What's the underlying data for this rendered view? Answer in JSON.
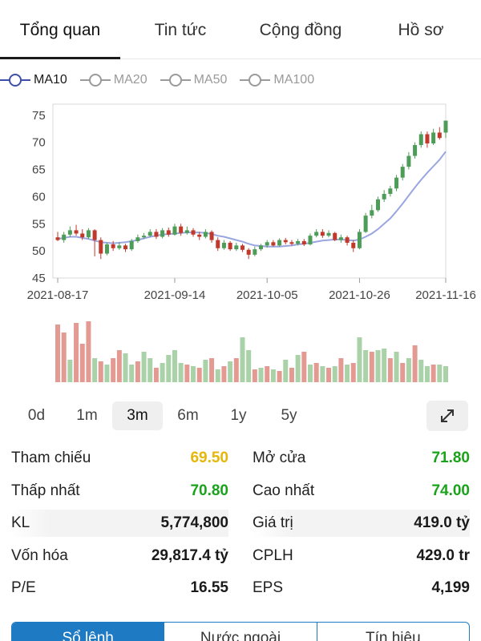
{
  "tabs": [
    "Tổng quan",
    "Tin tức",
    "Cộng đồng",
    "Hồ sơ"
  ],
  "legend": [
    {
      "label": "MA10",
      "active": true
    },
    {
      "label": "MA20",
      "active": false
    },
    {
      "label": "MA50",
      "active": false
    },
    {
      "label": "MA100",
      "active": false
    }
  ],
  "ranges": [
    "0d",
    "1m",
    "3m",
    "6m",
    "1y",
    "5y"
  ],
  "active_range": "3m",
  "expand_icon": "expand-icon",
  "stats": {
    "reference": {
      "label": "Tham chiếu",
      "value": "69.50"
    },
    "open": {
      "label": "Mở cửa",
      "value": "71.80"
    },
    "low": {
      "label": "Thấp nhất",
      "value": "70.80"
    },
    "high": {
      "label": "Cao nhất",
      "value": "74.00"
    },
    "volume": {
      "label": "KL",
      "value": "5,774,800"
    },
    "trade_value": {
      "label": "Giá trị",
      "value": "419.0 tỷ"
    },
    "market_cap": {
      "label": "Vốn hóa",
      "value": "29,817.4 tỷ"
    },
    "shares": {
      "label": "CPLH",
      "value": "429.0 tr"
    },
    "pe": {
      "label": "P/E",
      "value": "16.55"
    },
    "eps": {
      "label": "EPS",
      "value": "4,199"
    }
  },
  "bottom_tabs": [
    "Sổ lệnh",
    "Nước ngoài",
    "Tín hiệu"
  ],
  "colors": {
    "up": "#4d9c57",
    "down": "#c0392b",
    "ma": "#9aa6e0",
    "vol_up": "#a9d2a8",
    "vol_down": "#e39a92"
  },
  "chart_data": {
    "type": "candlestick",
    "y_ticks": [
      75,
      70,
      65,
      60,
      55,
      50,
      45
    ],
    "ylim": [
      45,
      76
    ],
    "x_labels": [
      "2021-08-17",
      "2021-09-14",
      "2021-10-05",
      "2021-10-26",
      "2021-11-16"
    ],
    "x_label_index": [
      0,
      19,
      34,
      49,
      63
    ],
    "candles": [
      [
        52.5,
        52.0,
        53.5,
        51.8
      ],
      [
        52.0,
        53.0,
        53.5,
        51.5
      ],
      [
        53.0,
        53.8,
        54.5,
        52.5
      ],
      [
        53.8,
        53.2,
        54.8,
        52.8
      ],
      [
        53.2,
        52.5,
        54.0,
        52.0
      ],
      [
        52.5,
        53.8,
        54.2,
        52.2
      ],
      [
        53.8,
        52.0,
        54.0,
        49.0
      ],
      [
        52.0,
        49.5,
        52.5,
        48.5
      ],
      [
        49.5,
        51.2,
        51.5,
        49.2
      ],
      [
        51.2,
        50.5,
        51.8,
        50.0
      ],
      [
        50.5,
        51.0,
        51.6,
        50.2
      ],
      [
        51.0,
        50.3,
        51.3,
        49.8
      ],
      [
        50.3,
        51.8,
        52.2,
        50.0
      ],
      [
        51.8,
        52.5,
        53.0,
        51.5
      ],
      [
        52.5,
        52.8,
        53.3,
        52.2
      ],
      [
        52.8,
        53.5,
        54.0,
        52.5
      ],
      [
        53.5,
        52.6,
        54.0,
        52.2
      ],
      [
        52.6,
        53.8,
        54.2,
        52.3
      ],
      [
        53.8,
        53.0,
        54.3,
        52.6
      ],
      [
        53.0,
        54.5,
        55.0,
        52.8
      ],
      [
        54.5,
        53.3,
        55.0,
        52.8
      ],
      [
        53.3,
        53.8,
        54.5,
        53.0
      ],
      [
        53.8,
        53.0,
        54.2,
        52.6
      ],
      [
        53.0,
        52.6,
        53.5,
        52.0
      ],
      [
        52.6,
        53.5,
        54.0,
        52.3
      ],
      [
        53.5,
        52.0,
        53.8,
        51.5
      ],
      [
        52.0,
        50.5,
        52.5,
        50.0
      ],
      [
        50.5,
        51.5,
        52.0,
        50.2
      ],
      [
        51.5,
        50.3,
        51.8,
        50.0
      ],
      [
        50.3,
        51.0,
        51.5,
        50.0
      ],
      [
        51.0,
        50.2,
        51.3,
        49.8
      ],
      [
        50.2,
        49.3,
        50.5,
        48.5
      ],
      [
        49.3,
        50.3,
        50.8,
        49.0
      ],
      [
        50.3,
        51.0,
        51.3,
        50.0
      ],
      [
        51.0,
        51.6,
        52.0,
        50.6
      ],
      [
        51.6,
        51.0,
        52.0,
        50.8
      ],
      [
        51.0,
        52.0,
        52.3,
        50.8
      ],
      [
        52.0,
        51.6,
        52.4,
        51.2
      ],
      [
        51.6,
        51.3,
        52.0,
        51.0
      ],
      [
        51.3,
        51.8,
        52.2,
        51.0
      ],
      [
        51.8,
        51.2,
        52.2,
        50.9
      ],
      [
        51.2,
        52.8,
        53.2,
        51.0
      ],
      [
        52.8,
        53.5,
        54.0,
        52.5
      ],
      [
        53.5,
        52.8,
        54.0,
        52.4
      ],
      [
        52.8,
        53.3,
        53.8,
        52.5
      ],
      [
        53.3,
        52.0,
        53.5,
        51.8
      ],
      [
        52.0,
        52.5,
        53.0,
        51.5
      ],
      [
        52.5,
        51.5,
        52.8,
        51.0
      ],
      [
        51.5,
        50.5,
        52.0,
        49.8
      ],
      [
        50.5,
        53.5,
        54.0,
        50.3
      ],
      [
        53.5,
        56.5,
        57.0,
        53.3
      ],
      [
        56.5,
        57.5,
        58.5,
        56.0
      ],
      [
        57.5,
        59.5,
        60.0,
        57.2
      ],
      [
        59.5,
        60.5,
        61.2,
        59.0
      ],
      [
        60.5,
        61.5,
        62.0,
        60.0
      ],
      [
        61.5,
        63.5,
        64.0,
        61.0
      ],
      [
        63.5,
        65.5,
        66.0,
        63.0
      ],
      [
        65.5,
        67.5,
        68.2,
        65.0
      ],
      [
        67.5,
        69.5,
        70.0,
        67.0
      ],
      [
        69.5,
        71.5,
        72.0,
        69.0
      ],
      [
        71.5,
        69.8,
        72.0,
        69.0
      ],
      [
        69.8,
        71.8,
        72.5,
        69.5
      ],
      [
        71.8,
        70.8,
        72.8,
        70.5
      ],
      [
        71.8,
        74.0,
        74.0,
        70.8
      ]
    ],
    "ma10": [
      52.2,
      52.4,
      52.6,
      52.6,
      52.4,
      52.2,
      51.9,
      51.6,
      51.5,
      51.4,
      51.5,
      51.6,
      51.8,
      52.0,
      52.3,
      52.6,
      52.8,
      53.0,
      53.1,
      53.2,
      53.3,
      53.4,
      53.4,
      53.4,
      53.3,
      53.1,
      52.8,
      52.6,
      52.3,
      52.0,
      51.7,
      51.3,
      51.0,
      50.9,
      50.8,
      50.8,
      50.8,
      50.9,
      51.0,
      51.2,
      51.3,
      51.5,
      51.7,
      51.9,
      52.0,
      52.1,
      52.1,
      52.0,
      51.9,
      52.1,
      52.6,
      53.2,
      54.0,
      55.0,
      56.0,
      57.3,
      58.7,
      60.2,
      61.7,
      63.1,
      64.4,
      65.6,
      66.8,
      68.3
    ],
    "volume": [
      [
        72,
        0
      ],
      [
        62,
        0
      ],
      [
        28,
        1
      ],
      [
        74,
        0
      ],
      [
        48,
        0
      ],
      [
        76,
        0
      ],
      [
        30,
        1
      ],
      [
        26,
        0
      ],
      [
        22,
        1
      ],
      [
        30,
        0
      ],
      [
        40,
        0
      ],
      [
        36,
        1
      ],
      [
        22,
        1
      ],
      [
        26,
        0
      ],
      [
        38,
        1
      ],
      [
        30,
        1
      ],
      [
        18,
        0
      ],
      [
        24,
        1
      ],
      [
        34,
        1
      ],
      [
        40,
        1
      ],
      [
        24,
        1
      ],
      [
        22,
        0
      ],
      [
        20,
        1
      ],
      [
        18,
        0
      ],
      [
        28,
        1
      ],
      [
        30,
        0
      ],
      [
        16,
        1
      ],
      [
        20,
        0
      ],
      [
        26,
        1
      ],
      [
        30,
        0
      ],
      [
        56,
        1
      ],
      [
        40,
        1
      ],
      [
        16,
        0
      ],
      [
        18,
        1
      ],
      [
        20,
        0
      ],
      [
        16,
        1
      ],
      [
        14,
        0
      ],
      [
        28,
        1
      ],
      [
        18,
        0
      ],
      [
        34,
        1
      ],
      [
        38,
        0
      ],
      [
        22,
        1
      ],
      [
        24,
        0
      ],
      [
        20,
        1
      ],
      [
        18,
        0
      ],
      [
        20,
        1
      ],
      [
        30,
        0
      ],
      [
        22,
        1
      ],
      [
        24,
        0
      ],
      [
        56,
        1
      ],
      [
        40,
        1
      ],
      [
        38,
        0
      ],
      [
        40,
        1
      ],
      [
        42,
        1
      ],
      [
        30,
        0
      ],
      [
        38,
        1
      ],
      [
        24,
        0
      ],
      [
        30,
        1
      ],
      [
        46,
        0
      ],
      [
        28,
        1
      ],
      [
        20,
        1
      ],
      [
        22,
        0
      ],
      [
        22,
        1
      ],
      [
        20,
        1
      ]
    ]
  }
}
